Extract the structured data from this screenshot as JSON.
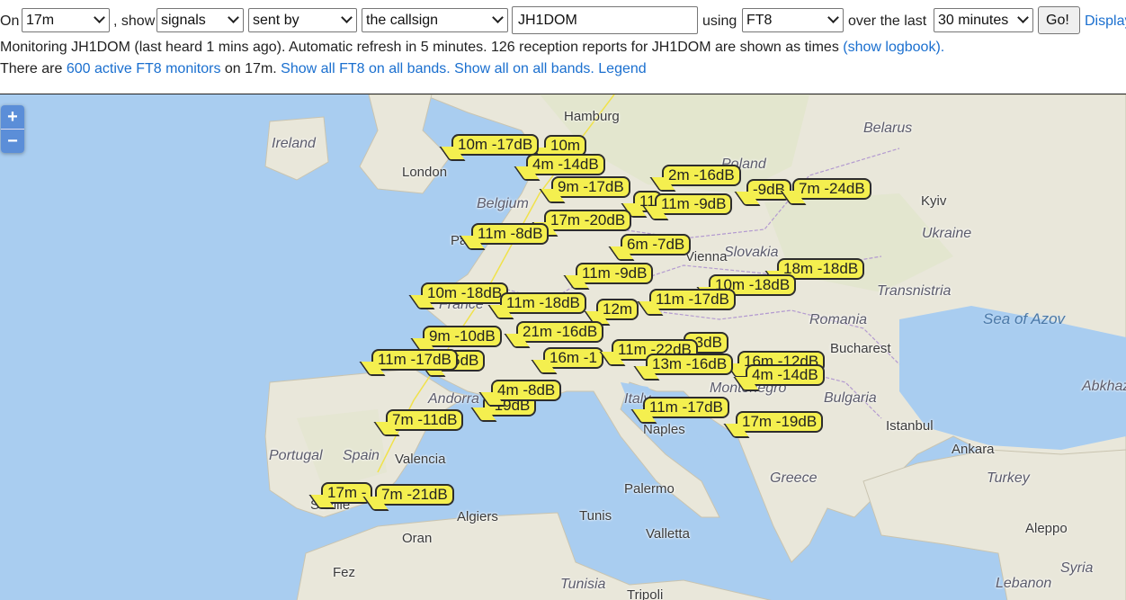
{
  "controls": {
    "on_label": "On",
    "band": "17m",
    "show_label": ", show",
    "mode_filter": "signals",
    "direction": "sent by",
    "target": "the callsign",
    "callsign": "JH1DOM",
    "using_label": "using",
    "protocol": "FT8",
    "over_label": "over the last",
    "period": "30 minutes",
    "go_label": "Go!",
    "display_label": "Display"
  },
  "status": {
    "line1_text": "Monitoring JH1DOM (last heard 1 mins ago). Automatic refresh in 5 minutes. 126 reception reports for JH1DOM are shown as times",
    "show_logbook": "(show logbook).",
    "line2_prefix": "There are",
    "monitors_link": "600 active FT8 monitors",
    "line2_mid": "on 17m.",
    "all_bands_link": "Show all FT8 on all bands.",
    "all_on_all_link": "Show all on all bands.",
    "legend_link": "Legend"
  },
  "map": {
    "zoom_in": "+",
    "zoom_out": "−",
    "places": [
      "Hamburg",
      "Ireland",
      "London",
      "Belgium",
      "Pa",
      "Belarus",
      "Kyiv",
      "Ukraine",
      "Slovakia",
      "Transnistria",
      "Romania",
      "Sea of Azov",
      "Bucharest",
      "Bulgaria",
      "Abkhaz",
      "Montenegro",
      "Italy",
      "Andorra",
      "Portugal",
      "Spain",
      "Valencia",
      "Naples",
      "Istanbul",
      "Ankara",
      "Turkey",
      "Greece",
      "Palermo",
      "Tunis",
      "Algiers",
      "Oran",
      "Valletta",
      "Fez",
      "Tunisia",
      "Tripoli",
      "Aleppo",
      "Syria",
      "Lebanon",
      "Seville",
      "France",
      "Vienna",
      "Poland"
    ],
    "reports": [
      "10m -17dB",
      "4m -14dB",
      "2m -16dB",
      "9m -17dB",
      "7m -24dB",
      "11m -9dB",
      "-9dB",
      "17m -20dB",
      "11m -8dB",
      "6m -7dB",
      "10m",
      "11m -9dB",
      "18m -18dB",
      "10m -18dB",
      "11m -18dB",
      "10m -18dB",
      "11m -17dB",
      "12m",
      "9m -10dB",
      "21m -16dB",
      "11m -17dB",
      "16m -1",
      "11m -22dB",
      "13m -16dB",
      "4m -14dB",
      "4m -8dB",
      "-19dB",
      "11m -17dB",
      "17m -19dB",
      "7m -11dB",
      "17m -",
      "7m -21dB",
      "-3dB",
      "16m -12dB",
      "-15dB",
      "11"
    ]
  }
}
